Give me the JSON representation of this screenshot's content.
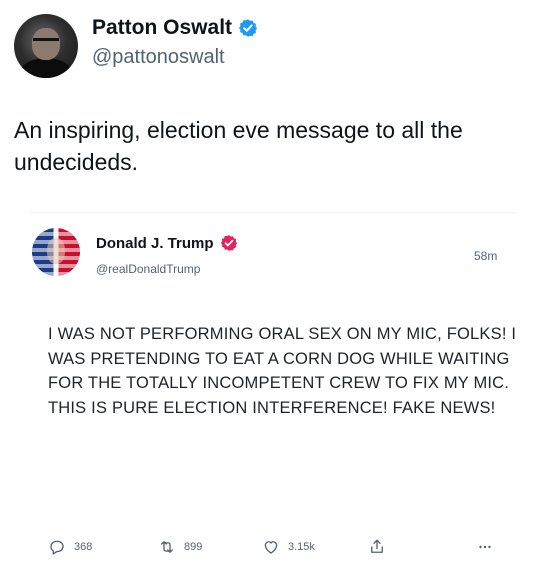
{
  "tweet": {
    "author_name": "Patton Oswalt",
    "handle": "@pattonoswalt",
    "text": "An inspiring, election eve message to all the undecideds.",
    "verified_color": "#1d9bf0"
  },
  "embedded_post": {
    "author_name": "Donald J. Trump",
    "handle": "@realDonaldTrump",
    "time": "58m",
    "verified_color": "#e0245e",
    "text": "I WAS NOT PERFORMING ORAL SEX ON MY MIC, FOLKS! I WAS PRETENDING TO EAT A CORN DOG WHILE WAITING FOR THE TOTALLY INCOMPETENT CREW TO FIX MY MIC. THIS IS PURE ELECTION INTERFERENCE! FAKE NEWS!",
    "actions": {
      "replies": "368",
      "reposts": "899",
      "likes": "3.15k"
    }
  },
  "icons": [
    "verified-badge-icon",
    "reply-icon",
    "repost-icon",
    "like-icon",
    "share-icon",
    "more-icon"
  ]
}
